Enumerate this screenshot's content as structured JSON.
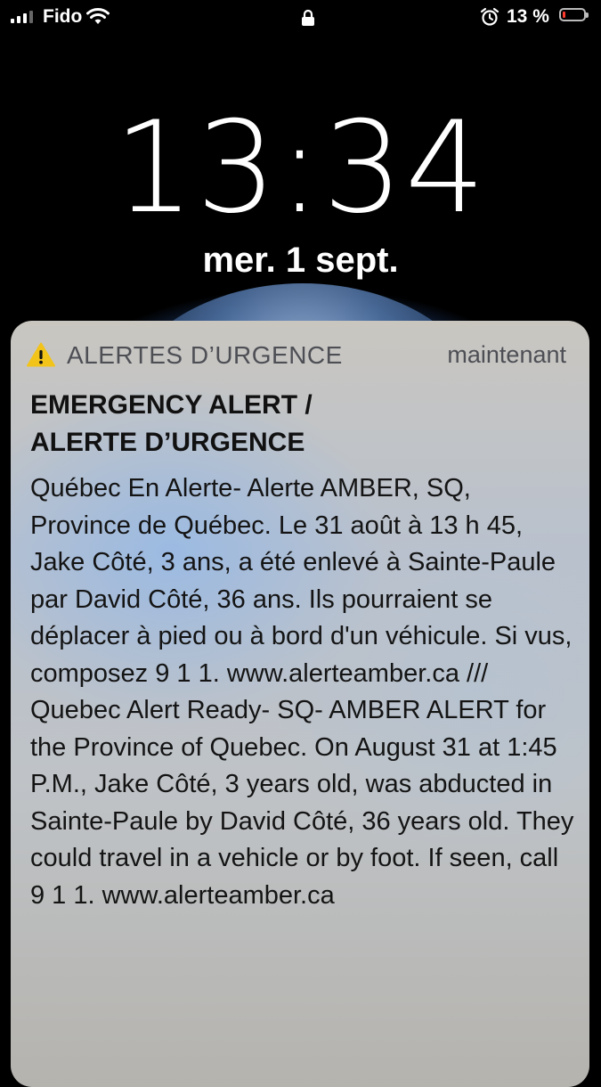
{
  "status_bar": {
    "carrier": "Fido",
    "battery_percent": "13 %",
    "battery_level": 0.13,
    "icons": [
      "signal-icon",
      "wifi-icon",
      "lock-icon",
      "alarm-icon",
      "battery-icon"
    ]
  },
  "lock_screen": {
    "time": "13:34",
    "date": "mer. 1 sept."
  },
  "notification": {
    "app_name": "ALERTES D’URGENCE",
    "timestamp": "maintenant",
    "icon": "warning-icon",
    "title": "EMERGENCY ALERT /\nALERTE D’URGENCE",
    "body": "Québec En Alerte- Alerte AMBER, SQ, Province de Québec. Le 31 août à 13 h 45, Jake Côté, 3 ans, a été enlevé à Sainte-Paule par David Côté, 36 ans. Ils pourraient se déplacer à pied ou à bord d'un véhicule. Si vus, composez 9 1 1. www.alerteamber.ca /// Quebec Alert Ready- SQ- AMBER ALERT for the Province of Quebec. On August 31 at 1:45 P.M., Jake Côté, 3 years old, was abducted in Sainte-Paule by David Côté, 36 years old.  They could travel in a vehicle or by foot. If seen, call 9 1 1. www.alerteamber.ca"
  },
  "colors": {
    "warning": "#f2c318",
    "battery_low": "#ff3b30"
  }
}
